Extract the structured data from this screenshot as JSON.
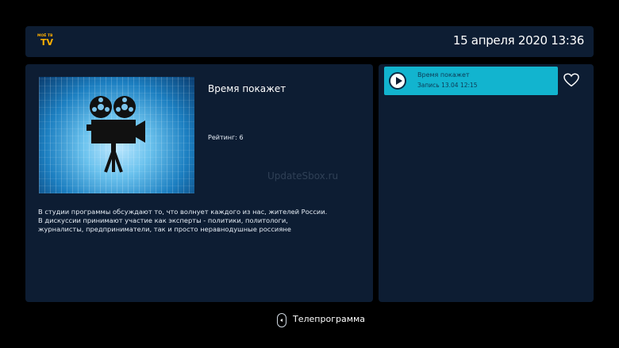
{
  "header": {
    "logo_top": "МОЁ ТВ",
    "logo_tv": "TV",
    "datetime": "15 апреля 2020 13:36"
  },
  "program": {
    "title": "Время покажет",
    "rating": "Рейтинг: 6",
    "watermark": "UpdateSbox.ru",
    "description": "В студии программы обсуждают то, что волнует каждого из нас, жителей России. В дискуссии принимают участие как эксперты - политики, политологи, журналисты, предприниматели, так и просто неравнодушные россияне",
    "poster_icon": "film-camera-icon"
  },
  "recordings": {
    "items": [
      {
        "title": "Время покажет",
        "subtitle": "Запись 13.04 12:15"
      }
    ],
    "favorite_icon": "heart-icon"
  },
  "footer": {
    "label": "Телепрограмма",
    "icon": "remote-dial-left-icon"
  },
  "colors": {
    "background": "#000000",
    "panel": "#0d1d33",
    "accent": "#12b4cf",
    "logo": "#ffb000"
  }
}
